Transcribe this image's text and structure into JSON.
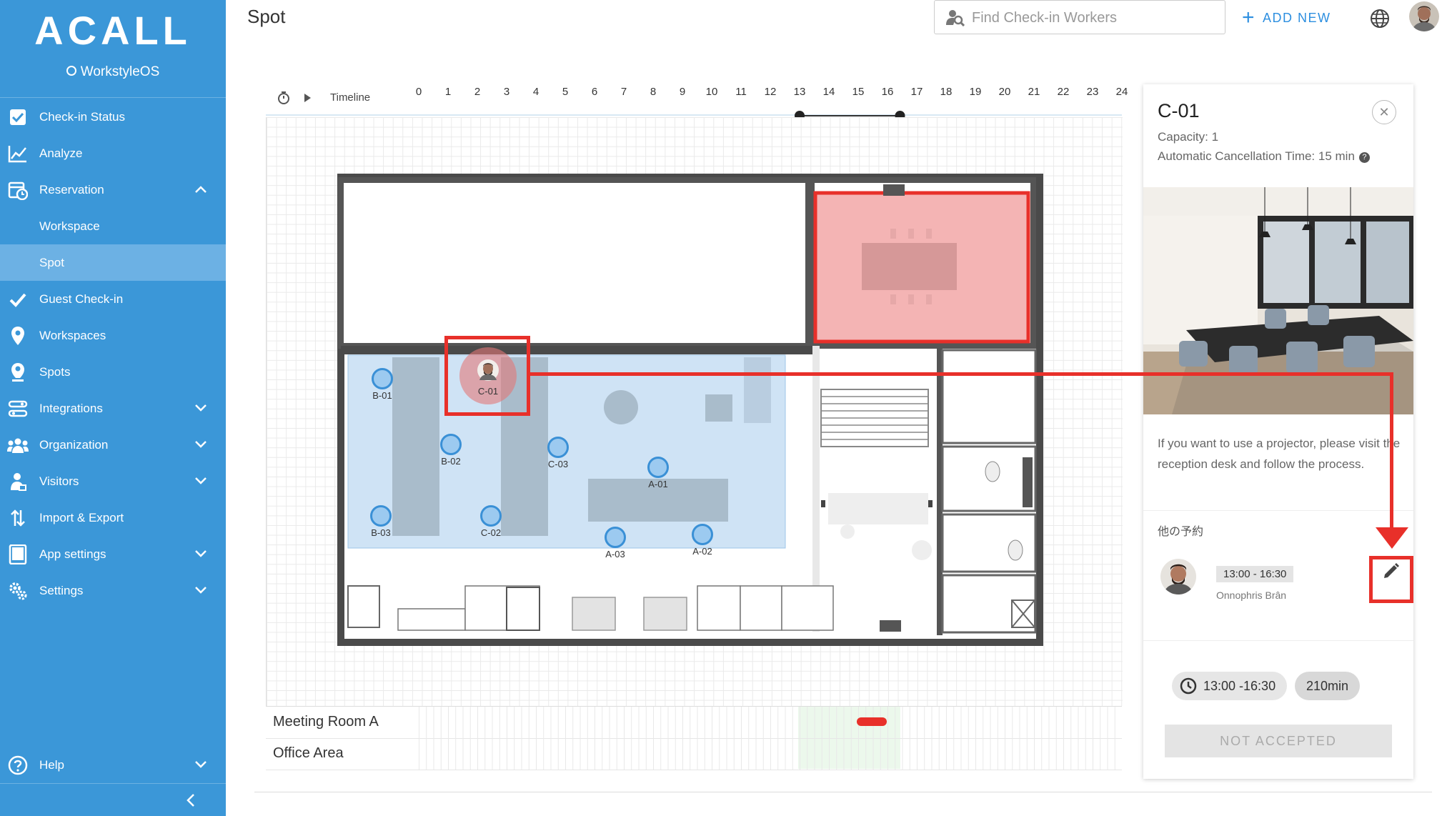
{
  "app": {
    "logo": "ACALL",
    "logo_sub": "WorkstyleOS"
  },
  "sidebar": {
    "items": [
      {
        "label": "Check-in Status",
        "icon": "checkbox-icon"
      },
      {
        "label": "Analyze",
        "icon": "line-chart-icon"
      },
      {
        "label": "Reservation",
        "icon": "calendar-clock-icon",
        "expanded": true
      },
      {
        "label": "Workspace",
        "sub": true
      },
      {
        "label": "Spot",
        "sub": true,
        "active": true
      },
      {
        "label": "Guest Check-in",
        "icon": "checkmark-icon"
      },
      {
        "label": "Workspaces",
        "icon": "map-pin-icon"
      },
      {
        "label": "Spots",
        "icon": "map-pin-person-icon"
      },
      {
        "label": "Integrations",
        "icon": "integrations-icon",
        "expandable": true
      },
      {
        "label": "Organization",
        "icon": "people-icon",
        "expandable": true
      },
      {
        "label": "Visitors",
        "icon": "visitor-icon",
        "expandable": true
      },
      {
        "label": "Import & Export",
        "icon": "import-export-icon"
      },
      {
        "label": "App settings",
        "icon": "tablet-icon",
        "expandable": true
      },
      {
        "label": "Settings",
        "icon": "gears-icon",
        "expandable": true
      }
    ],
    "help": "Help"
  },
  "header": {
    "title": "Spot",
    "search_placeholder": "Find Check-in Workers",
    "add_new": "ADD NEW"
  },
  "timeline": {
    "label": "Timeline",
    "hours": [
      "0",
      "1",
      "2",
      "3",
      "4",
      "5",
      "6",
      "7",
      "8",
      "9",
      "10",
      "11",
      "12",
      "13",
      "14",
      "15",
      "16",
      "17",
      "18",
      "19",
      "20",
      "21",
      "22",
      "23",
      "24"
    ],
    "selected_start_hour": 13,
    "selected_end_hour": 16.5
  },
  "spots": [
    {
      "id": "B-01"
    },
    {
      "id": "B-02"
    },
    {
      "id": "B-03"
    },
    {
      "id": "C-01"
    },
    {
      "id": "C-02"
    },
    {
      "id": "C-03"
    },
    {
      "id": "A-01"
    },
    {
      "id": "A-02"
    },
    {
      "id": "A-03"
    }
  ],
  "rows": [
    "Meeting Room A",
    "Office Area"
  ],
  "panel": {
    "title": "C-01",
    "capacity": "Capacity: 1",
    "cancel_time": "Automatic Cancellation Time: 15 min",
    "description": "If you want to use a projector, please visit the reception desk and follow the process.",
    "other_reservations_label": "他の予約",
    "reservation": {
      "time": "13:00 - 16:30",
      "name": "Onnophris Brân"
    },
    "selected_time": "13:00 -16:30",
    "duration": "210min",
    "status_button": "NOT ACCEPTED"
  },
  "colors": {
    "sidebar": "#3b97d8",
    "accent": "#2d8fe0",
    "annotation": "#e8302a"
  }
}
